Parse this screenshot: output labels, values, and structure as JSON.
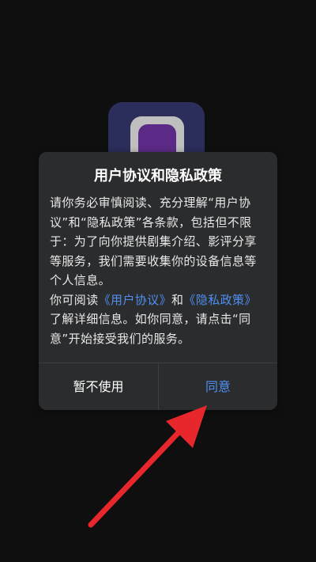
{
  "dialog": {
    "title": "用户协议和隐私政策",
    "paragraph1": "请你务必审慎阅读、充分理解“用户协议”和“隐私政策”各条款，包括但不限于：为了向你提供剧集介绍、影评分享等服务，我们需要收集你的设备信息等个人信息。",
    "paragraph2_prefix": "你可阅读",
    "user_agreement_link": "《用户协议》",
    "paragraph2_and": "和",
    "privacy_policy_link": "《隐私政策》",
    "paragraph2_suffix": "了解详细信息。如你同意，请点击“同意”开始接受我们的服务。",
    "decline_label": "暂不使用",
    "agree_label": "同意"
  },
  "colors": {
    "background": "#0f0f10",
    "dialog_background": "#2b2c2e",
    "link": "#4f8ff0",
    "annotation_arrow": "#e8272d"
  },
  "icons": {
    "app_icon": "app-logo-icon",
    "annotation": "red-arrow-icon"
  }
}
